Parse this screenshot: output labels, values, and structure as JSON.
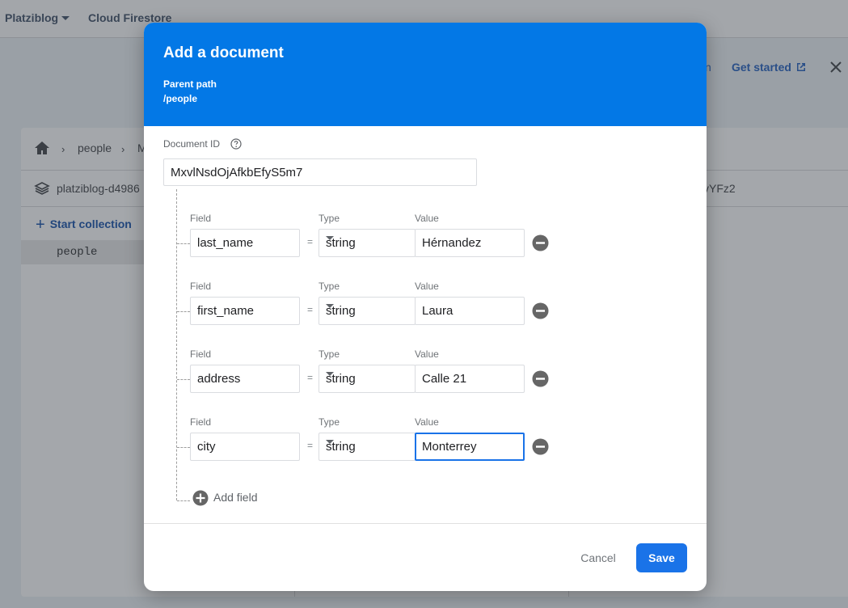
{
  "topbar": {
    "project": "Platziblog",
    "product": "Cloud Firestore",
    "partial_link": "n",
    "get_started": "Get started"
  },
  "panel": {
    "breadcrumb": [
      "people",
      "M"
    ],
    "database": "platziblog-d4986",
    "database_right": "vYFz2",
    "start_collection": "Start collection",
    "collections": [
      "people"
    ]
  },
  "dialog": {
    "title": "Add a document",
    "parent_path_label": "Parent path",
    "parent_path": "/people",
    "document_id_label": "Document ID",
    "document_id": "MxvlNsdOjAfkbEfyS5m7",
    "labels": {
      "field": "Field",
      "type": "Type",
      "value": "Value",
      "equals": "="
    },
    "fields": [
      {
        "name": "last_name",
        "type": "string",
        "value": "Hérnandez"
      },
      {
        "name": "first_name",
        "type": "string",
        "value": "Laura"
      },
      {
        "name": "address",
        "type": "string",
        "value": "Calle 21"
      },
      {
        "name": "city",
        "type": "string",
        "value": "Monterrey"
      }
    ],
    "add_field": "Add field",
    "cancel": "Cancel",
    "save": "Save",
    "accent_color": "#0378e6"
  }
}
